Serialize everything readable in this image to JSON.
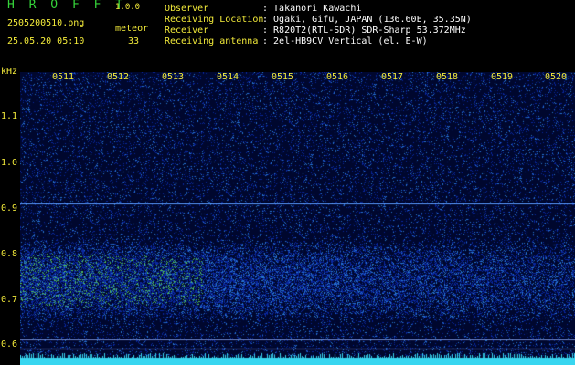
{
  "header": {
    "title": "H R O F F T",
    "version": "1.0.0",
    "filename": "2505200510.png",
    "datetime": "25.05.20 05:10",
    "meteor_label": "meteor",
    "meteor_count": "33"
  },
  "meta": [
    {
      "key": "Observer",
      "value": ": Takanori Kawachi"
    },
    {
      "key": "Receiving Location",
      "value": ": Ogaki, Gifu, JAPAN (136.60E, 35.35N)"
    },
    {
      "key": "Receiver",
      "value": ": R820T2(RTL-SDR) SDR-Sharp 53.372MHz"
    },
    {
      "key": "Receiving antenna",
      "value": ": 2el-HB9CV Vertical (el. E-W)"
    }
  ],
  "axes": {
    "y_unit": "kHz",
    "y_ticks": [
      "1.1",
      "1.0",
      "0.9",
      "0.8",
      "0.7",
      "0.6"
    ],
    "x_ticks": [
      "0511",
      "0512",
      "0513",
      "0514",
      "0515",
      "0516",
      "0517",
      "0518",
      "0519",
      "0520"
    ]
  },
  "colors": {
    "label_yellow": "#f4ec3a",
    "title_green": "#35d43a",
    "background": "#000000",
    "noise_floor": "#00072e",
    "carrier_line": "#5a9cff",
    "meteor_band": "#7bbf6a",
    "baseline": "#38d6f0"
  },
  "features": {
    "carrier_khz": 0.92,
    "band_center_khz": 0.75,
    "band_halfwidth_khz": 0.09,
    "ref_lines_khz": [
      0.62,
      0.6
    ]
  }
}
